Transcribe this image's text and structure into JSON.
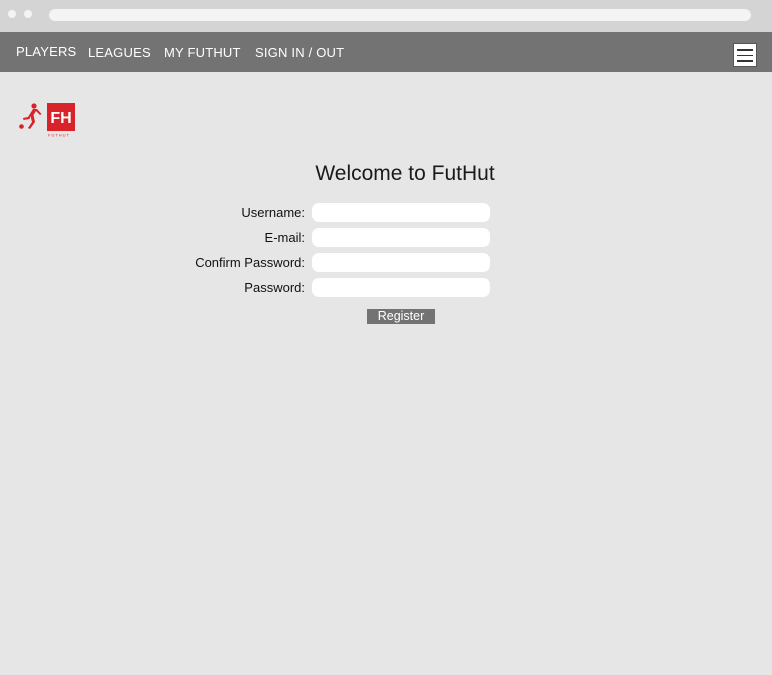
{
  "navbar": {
    "links": [
      {
        "label": "PLAYERS"
      },
      {
        "label": "LEAGUES"
      },
      {
        "label": "MY FUTHUT"
      },
      {
        "label": "SIGN IN / OUT"
      }
    ],
    "menu_icon": "hamburger-menu-icon",
    "background_color": "#737373"
  },
  "logo": {
    "text": "FH",
    "subtext": "FUTHUT",
    "brand_color": "#d8232a"
  },
  "page": {
    "title": "Welcome to FutHut"
  },
  "form": {
    "fields": [
      {
        "label": "Username:",
        "value": "",
        "placeholder": ""
      },
      {
        "label": "E-mail:",
        "value": "",
        "placeholder": ""
      },
      {
        "label": "Confirm Password:",
        "value": "",
        "placeholder": ""
      },
      {
        "label": "Password:",
        "value": "",
        "placeholder": ""
      }
    ],
    "submit_label": "Register"
  }
}
